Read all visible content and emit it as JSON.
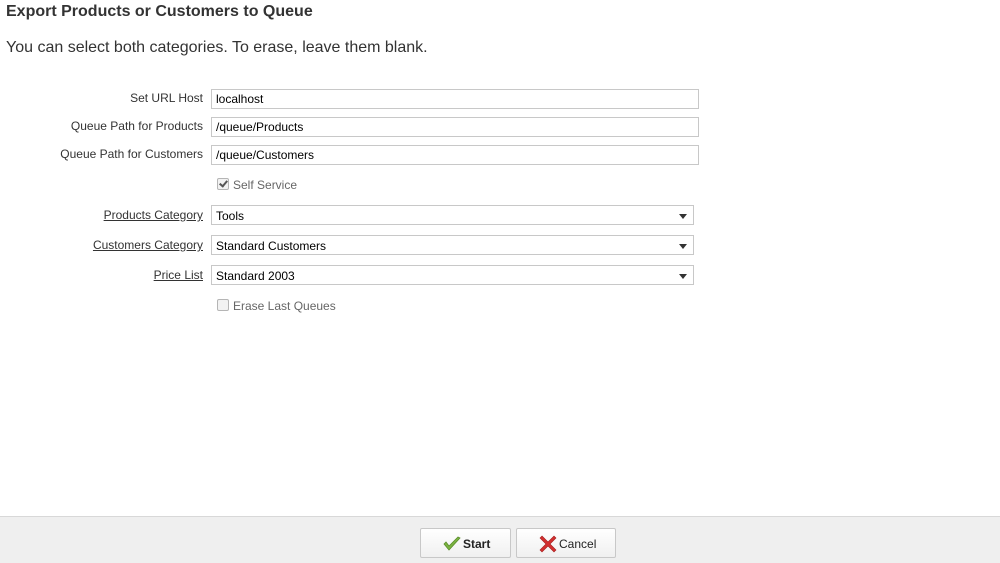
{
  "header": {
    "title": "Export Products or Customers to Queue",
    "subtitle": "You can select both categories. To erase, leave them blank."
  },
  "form": {
    "url_host": {
      "label": "Set URL Host",
      "value": "localhost"
    },
    "products_path": {
      "label": "Queue Path for Products",
      "value": "/queue/Products"
    },
    "customers_path": {
      "label": "Queue Path for Customers",
      "value": "/queue/Customers"
    },
    "self_service": {
      "label": "Self Service",
      "checked": true
    },
    "products_category": {
      "label": "Products Category",
      "value": "Tools"
    },
    "customers_category": {
      "label": "Customers Category",
      "value": "Standard Customers"
    },
    "price_list": {
      "label": "Price List",
      "value": "Standard 2003"
    },
    "erase_last_queues": {
      "label": "Erase Last Queues",
      "checked": false
    }
  },
  "footer": {
    "start_label": "Start",
    "cancel_label": "Cancel"
  },
  "colors": {
    "footer_bg": "#efefef",
    "start_icon": "#7cb342",
    "cancel_icon": "#d32f2f"
  }
}
